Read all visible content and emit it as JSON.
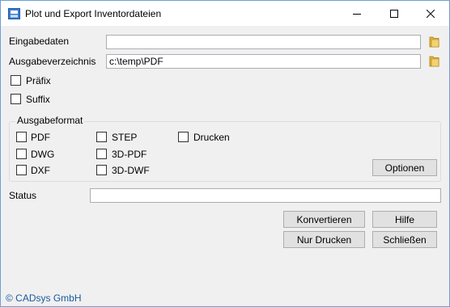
{
  "window": {
    "title": "Plot und Export Inventordateien"
  },
  "input": {
    "label": "Eingabedaten",
    "value": ""
  },
  "output": {
    "label": "Ausgabeverzeichnis",
    "value": "c:\\temp\\PDF"
  },
  "options": {
    "prefix": "Präfix",
    "suffix": "Suffix"
  },
  "format": {
    "title": "Ausgabeformat",
    "pdf": "PDF",
    "dwg": "DWG",
    "dxf": "DXF",
    "step": "STEP",
    "pdf3d": "3D-PDF",
    "dwf3d": "3D-DWF",
    "print": "Drucken",
    "options_button": "Optionen"
  },
  "status": {
    "label": "Status",
    "value": ""
  },
  "buttons": {
    "convert": "Konvertieren",
    "help": "Hilfe",
    "print_only": "Nur Drucken",
    "close": "Schließen"
  },
  "footer": {
    "copyright": "© CADsys GmbH"
  },
  "colors": {
    "accent_border": "#6f9fd6",
    "link": "#1a5aa0",
    "folder": "#e4b63a"
  }
}
